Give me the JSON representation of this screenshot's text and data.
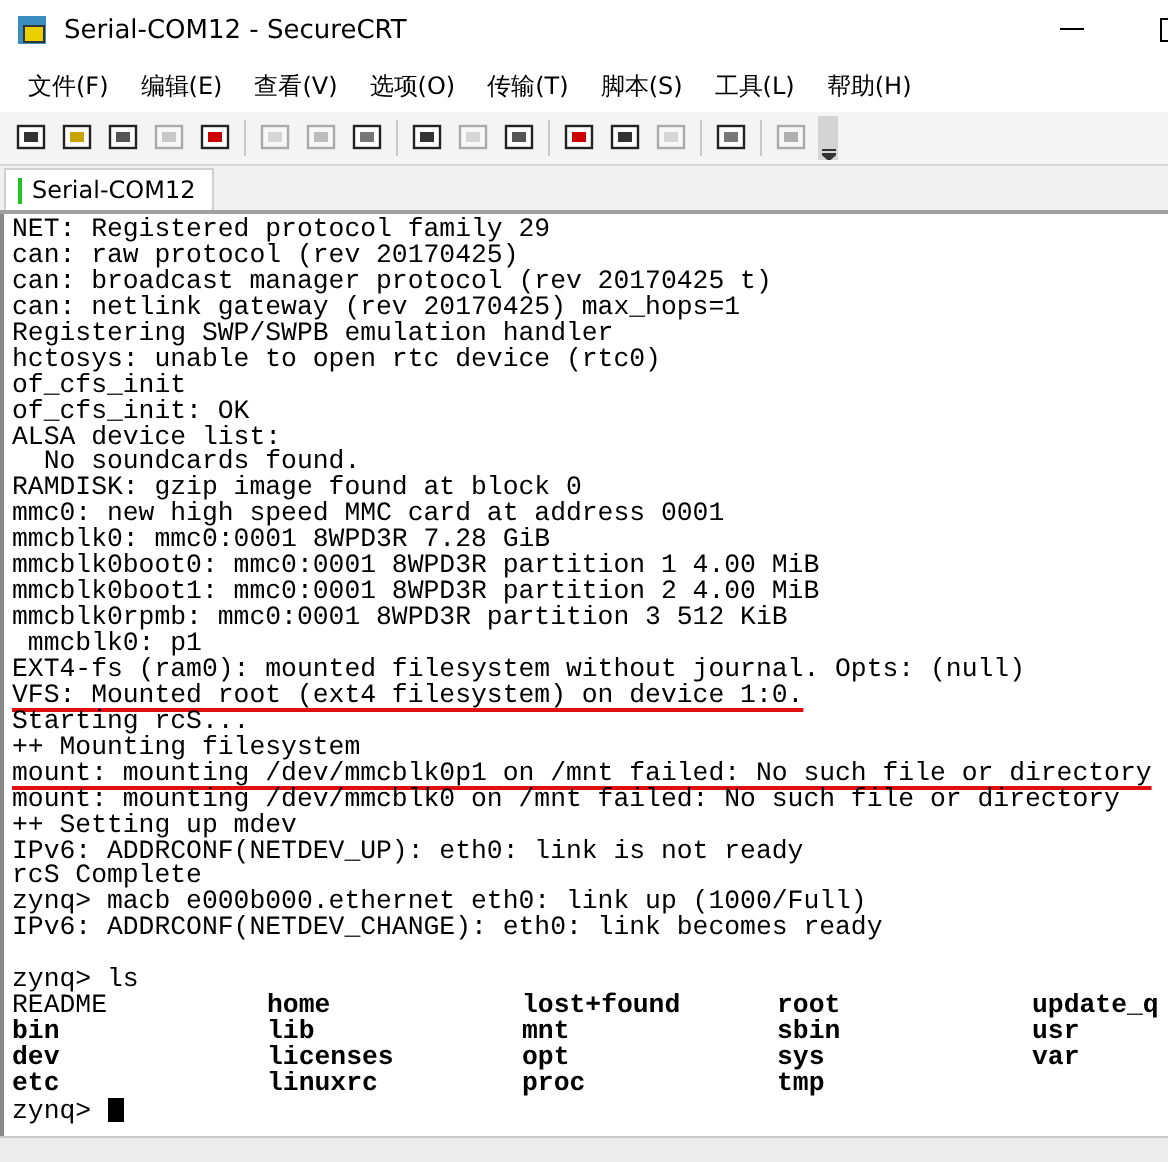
{
  "window": {
    "title": "Serial-COM12 - SecureCRT"
  },
  "menu": [
    "文件(F)",
    "编辑(E)",
    "查看(V)",
    "选项(O)",
    "传输(T)",
    "脚本(S)",
    "工具(L)",
    "帮助(H)"
  ],
  "toolbar": [
    {
      "kind": "button",
      "disabled": false
    },
    {
      "kind": "button",
      "disabled": false
    },
    {
      "kind": "button",
      "disabled": false
    },
    {
      "kind": "button",
      "disabled": true
    },
    {
      "kind": "button",
      "disabled": false
    },
    {
      "kind": "separator"
    },
    {
      "kind": "button",
      "disabled": true
    },
    {
      "kind": "button",
      "disabled": true
    },
    {
      "kind": "button",
      "disabled": false
    },
    {
      "kind": "separator"
    },
    {
      "kind": "button",
      "disabled": false
    },
    {
      "kind": "button",
      "disabled": true
    },
    {
      "kind": "button",
      "disabled": false
    },
    {
      "kind": "separator"
    },
    {
      "kind": "button",
      "disabled": false
    },
    {
      "kind": "button",
      "disabled": false
    },
    {
      "kind": "button",
      "disabled": true
    },
    {
      "kind": "separator"
    },
    {
      "kind": "button",
      "disabled": false
    },
    {
      "kind": "separator"
    },
    {
      "kind": "button",
      "disabled": true
    }
  ],
  "tabs": [
    {
      "label": "Serial-COM12",
      "selected": true,
      "color": "#22c322"
    }
  ],
  "terminal": {
    "lines": [
      {
        "text": "NET: Registered protocol family 29",
        "underlined": false
      },
      {
        "text": "can: raw protocol (rev 20170425)",
        "underlined": false
      },
      {
        "text": "can: broadcast manager protocol (rev 20170425 t)",
        "underlined": false
      },
      {
        "text": "can: netlink gateway (rev 20170425) max_hops=1",
        "underlined": false
      },
      {
        "text": "Registering SWP/SWPB emulation handler",
        "underlined": false
      },
      {
        "text": "hctosys: unable to open rtc device (rtc0)",
        "underlined": false
      },
      {
        "text": "of_cfs_init",
        "underlined": false
      },
      {
        "text": "of_cfs_init: OK",
        "underlined": false
      },
      {
        "text": "ALSA device list:",
        "underlined": false
      },
      {
        "text": "  No soundcards found.",
        "underlined": false
      },
      {
        "text": "RAMDISK: gzip image found at block 0",
        "underlined": false
      },
      {
        "text": "mmc0: new high speed MMC card at address 0001",
        "underlined": false
      },
      {
        "text": "mmcblk0: mmc0:0001 8WPD3R 7.28 GiB",
        "underlined": false
      },
      {
        "text": "mmcblk0boot0: mmc0:0001 8WPD3R partition 1 4.00 MiB",
        "underlined": false
      },
      {
        "text": "mmcblk0boot1: mmc0:0001 8WPD3R partition 2 4.00 MiB",
        "underlined": false
      },
      {
        "text": "mmcblk0rpmb: mmc0:0001 8WPD3R partition 3 512 KiB",
        "underlined": false
      },
      {
        "text": " mmcblk0: p1",
        "underlined": false
      },
      {
        "text": "EXT4-fs (ram0): mounted filesystem without journal. Opts: (null)",
        "underlined": false
      },
      {
        "text": "VFS: Mounted root (ext4 filesystem) on device 1:0.",
        "underlined": true
      },
      {
        "text": "Starting rcS...",
        "underlined": false
      },
      {
        "text": "++ Mounting filesystem",
        "underlined": false
      },
      {
        "text": "mount: mounting /dev/mmcblk0p1 on /mnt failed: No such file or directory",
        "underlined": true
      },
      {
        "text": "mount: mounting /dev/mmcblk0 on /mnt failed: No such file or directory",
        "underlined": false
      },
      {
        "text": "++ Setting up mdev",
        "underlined": false
      },
      {
        "text": "IPv6: ADDRCONF(NETDEV_UP): eth0: link is not ready",
        "underlined": false
      },
      {
        "text": "rcS Complete",
        "underlined": false
      },
      {
        "text": "zynq> macb e000b000.ethernet eth0: link up (1000/Full)",
        "underlined": false
      },
      {
        "text": "IPv6: ADDRCONF(NETDEV_CHANGE): eth0: link becomes ready",
        "underlined": false
      }
    ],
    "command": "zynq> ls",
    "listing": [
      [
        {
          "name": "README",
          "kind": "file"
        },
        {
          "name": "home",
          "kind": "dir"
        },
        {
          "name": "lost+found",
          "kind": "dir"
        },
        {
          "name": "root",
          "kind": "dir"
        },
        {
          "name": "update_q",
          "kind": "dir"
        }
      ],
      [
        {
          "name": "bin",
          "kind": "dir"
        },
        {
          "name": "lib",
          "kind": "dir"
        },
        {
          "name": "mnt",
          "kind": "dir"
        },
        {
          "name": "sbin",
          "kind": "dir"
        },
        {
          "name": "usr",
          "kind": "dir"
        }
      ],
      [
        {
          "name": "dev",
          "kind": "dir"
        },
        {
          "name": "licenses",
          "kind": "dir"
        },
        {
          "name": "opt",
          "kind": "dir"
        },
        {
          "name": "sys",
          "kind": "dir"
        },
        {
          "name": "var",
          "kind": "dir"
        }
      ],
      [
        {
          "name": "etc",
          "kind": "dir"
        },
        {
          "name": "linuxrc",
          "kind": "dir"
        },
        {
          "name": "proc",
          "kind": "dir"
        },
        {
          "name": "tmp",
          "kind": "dir"
        }
      ]
    ],
    "prompt": "zynq>"
  }
}
